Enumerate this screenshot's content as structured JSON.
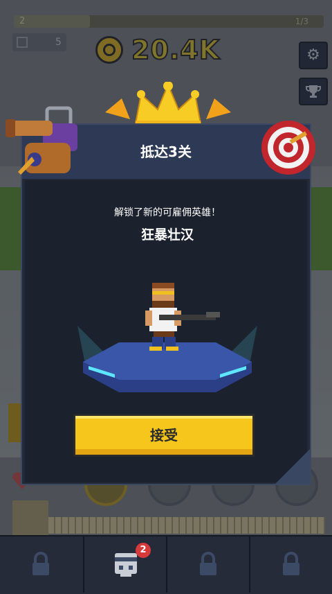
{
  "hud": {
    "level_number": "2",
    "level_progress": "1/3",
    "stat_value": "5",
    "coins": "20.4K"
  },
  "icons": {
    "settings": "gear-icon",
    "trophy": "trophy-icon",
    "coin": "coin-icon",
    "lock": "lock-icon",
    "hero": "hero-face-icon"
  },
  "dialog": {
    "title": "抵达3关",
    "message": "解锁了新的可雇佣英雄！",
    "hero_name": "狂暴壮汉",
    "accept_label": "接受"
  },
  "bottom_bar": {
    "hero_badge_count": "2"
  },
  "colors": {
    "accent_yellow": "#f6c61c",
    "dialog_bg": "#222a37",
    "dialog_header": "#2e3a55",
    "badge_red": "#d63a3a",
    "platform_blue": "#3a56a8",
    "glow_cyan": "#5ee6ff"
  }
}
